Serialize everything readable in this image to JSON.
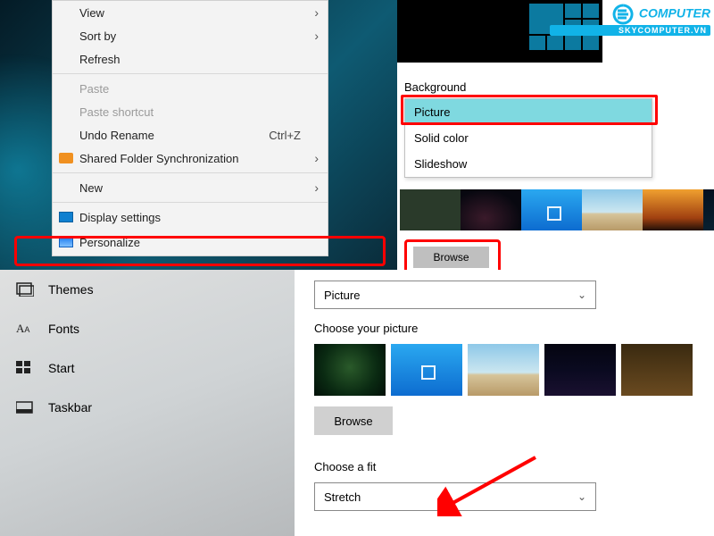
{
  "context_menu": {
    "view": "View",
    "sort_by": "Sort by",
    "refresh": "Refresh",
    "paste": "Paste",
    "paste_shortcut": "Paste shortcut",
    "undo_rename": "Undo Rename",
    "undo_shortcut": "Ctrl+Z",
    "shared_folder": "Shared Folder Synchronization",
    "new": "New",
    "display_settings": "Display settings",
    "personalize": "Personalize"
  },
  "bg_panel": {
    "label": "Background",
    "options": {
      "picture": "Picture",
      "solid": "Solid color",
      "slideshow": "Slideshow"
    },
    "browse": "Browse"
  },
  "watermark": {
    "brand": "COMPUTER",
    "site": "SKYCOMPUTER.VN"
  },
  "sidebar": {
    "themes": "Themes",
    "fonts": "Fonts",
    "start": "Start",
    "taskbar": "Taskbar"
  },
  "settings": {
    "bg_select": "Picture",
    "choose_picture": "Choose your picture",
    "browse": "Browse",
    "choose_fit": "Choose a fit",
    "fit_value": "Stretch"
  }
}
